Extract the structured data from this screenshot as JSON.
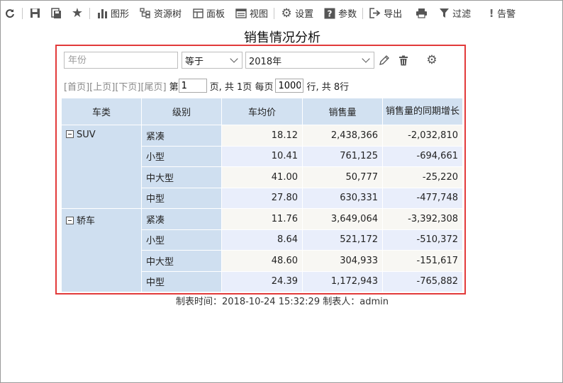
{
  "toolbar": {
    "chart_label": "图形",
    "resource_tree_label": "资源树",
    "panel_label": "面板",
    "view_label": "视图",
    "settings_label": "设置",
    "params_label": "参数",
    "export_label": "导出",
    "filter_label": "过滤",
    "alert_label": "告警"
  },
  "report": {
    "title": "销售情况分析",
    "filter": {
      "field_placeholder": "年份",
      "operator": "等于",
      "value": "2018年"
    },
    "pager": {
      "first": "[首页]",
      "prev": "[上页]",
      "next": "[下页]",
      "last": "[尾页]",
      "page_prefix": "第",
      "page_value": "1",
      "page_suffix": "页, 共 1页 每页",
      "rows_value": "1000",
      "rows_suffix": "行, 共 8行"
    },
    "columns": [
      "车类",
      "级别",
      "车均价",
      "销售量",
      "销售量的同期增长"
    ],
    "groups": [
      {
        "name": "SUV",
        "rows": [
          {
            "level": "紧凑",
            "avg_price": "18.12",
            "sales": "2,438,366",
            "yoy": "-2,032,810"
          },
          {
            "level": "小型",
            "avg_price": "10.41",
            "sales": "761,125",
            "yoy": "-694,661"
          },
          {
            "level": "中大型",
            "avg_price": "41.00",
            "sales": "50,777",
            "yoy": "-25,220"
          },
          {
            "level": "中型",
            "avg_price": "27.80",
            "sales": "630,331",
            "yoy": "-477,748"
          }
        ]
      },
      {
        "name": "轿车",
        "rows": [
          {
            "level": "紧凑",
            "avg_price": "11.76",
            "sales": "3,649,064",
            "yoy": "-3,392,308"
          },
          {
            "level": "小型",
            "avg_price": "8.64",
            "sales": "521,172",
            "yoy": "-510,372"
          },
          {
            "level": "中大型",
            "avg_price": "48.60",
            "sales": "304,933",
            "yoy": "-151,617"
          },
          {
            "level": "中型",
            "avg_price": "24.39",
            "sales": "1,172,943",
            "yoy": "-765,882"
          }
        ]
      }
    ],
    "footer": "制表时间：2018-10-24 15:32:29   制表人：admin"
  },
  "colors": {
    "highlight_border": "#e23a3a",
    "header_bg": "#d2e1f1",
    "row_odd": "#f8f7f3",
    "row_even": "#e9eefb"
  }
}
